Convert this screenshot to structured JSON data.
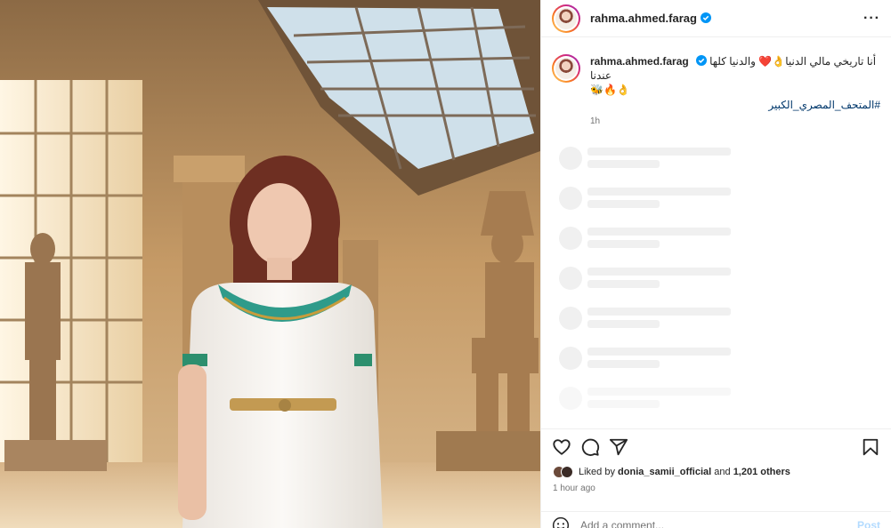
{
  "post": {
    "username": "rahma.ahmed.farag",
    "caption_text": "أنا تاريخي مالي الدنيا👌❤️ والدنيا كلها عندنا",
    "caption_emoji": "🐝🔥👌",
    "hashtag": "#المتحف_المصري_الكبير",
    "caption_time": "1h",
    "liked_by_prefix": "Liked by",
    "liked_by_user": "donia_samii_official",
    "liked_by_and": "and",
    "liked_by_count": "1,201 others",
    "posted_ago": "1 hour ago"
  },
  "comment_box": {
    "placeholder": "Add a comment...",
    "post_label": "Post"
  },
  "icons": {
    "more": "more-options-icon",
    "verified": "verified-badge-icon",
    "like": "heart-icon",
    "comment": "comment-icon",
    "share": "share-icon",
    "save": "bookmark-icon",
    "emoji": "emoji-icon"
  },
  "colors": {
    "verified": "#0095f6",
    "link": "#00376b",
    "post_disabled": "#b3dbff"
  }
}
